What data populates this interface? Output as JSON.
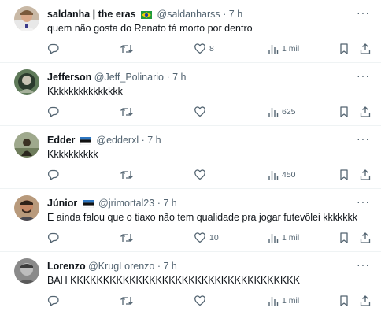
{
  "tweets": [
    {
      "name": "saldanha | the eras",
      "flag": "brazil",
      "handle": "@saldanharss",
      "time": "7 h",
      "text": "quem não gosta do Renato tá morto por dentro",
      "likes": "8",
      "views": "1 mil"
    },
    {
      "name": "Jefferson",
      "flag": "",
      "handle": "@Jeff_Polinario",
      "time": "7 h",
      "text": "Kkkkkkkkkkkkkkk",
      "likes": "",
      "views": "625"
    },
    {
      "name": "Edder",
      "flag": "gremio",
      "handle": "@edderxl",
      "time": "7 h",
      "text": "Kkkkkkkkkk",
      "likes": "",
      "views": "450"
    },
    {
      "name": "Júnior",
      "flag": "gremio",
      "handle": "@jrimortal23",
      "time": "7 h",
      "text": "E ainda falou que o tiaxo não tem qualidade pra jogar futevôlei kkkkkkk",
      "likes": "10",
      "views": "1 mil"
    },
    {
      "name": "Lorenzo",
      "flag": "",
      "handle": "@KrugLorenzo",
      "time": "7 h",
      "text": "BAH KKKKKKKKKKKKKKKKKKKKKKKKKKKKKKKKKKK",
      "likes": "",
      "views": "1 mil"
    }
  ],
  "separator": "·",
  "icons": [
    "reply-icon",
    "retweet-icon",
    "like-icon",
    "views-icon",
    "bookmark-icon",
    "share-icon",
    "more-icon"
  ],
  "colors": {
    "text": "#0f1419",
    "muted": "#536471",
    "divider": "#eff3f4",
    "background": "#ffffff"
  }
}
